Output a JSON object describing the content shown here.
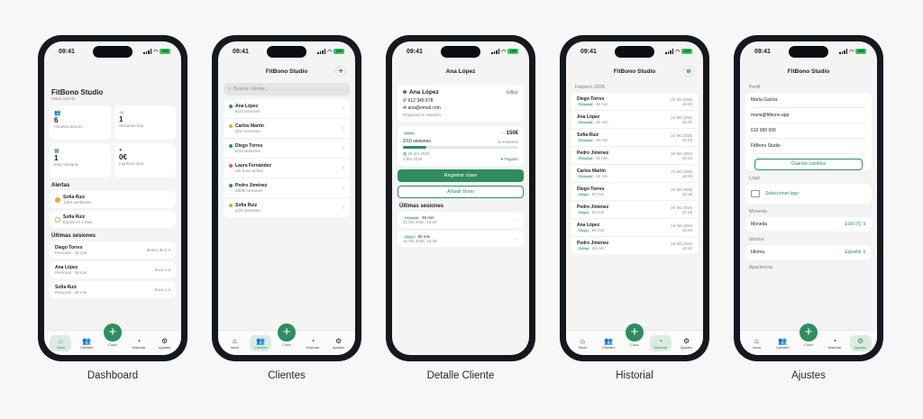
{
  "colors": {
    "accent": "#2f8d5f",
    "warning": "#f0a23a",
    "danger": "#e05a4f",
    "background": "#f6f7f6"
  },
  "status": {
    "time": "09:41",
    "battery": "100"
  },
  "tabs": [
    {
      "label": "Inicio",
      "icon": "home-icon"
    },
    {
      "label": "Clientes",
      "icon": "users-icon"
    },
    {
      "label": "Historial",
      "icon": "clock-icon"
    },
    {
      "label": "Ajustes",
      "icon": "gear-icon"
    }
  ],
  "fab_label": "Clase",
  "captions": [
    "Dashboard",
    "Clientes",
    "Detalle Cliente",
    "Historial",
    "Ajustes"
  ],
  "dashboard": {
    "title": "FitBono Studio",
    "subtitle": "María García",
    "stats": [
      {
        "value": "6",
        "label": "Clientes activos",
        "icon": "users-icon"
      },
      {
        "value": "1",
        "label": "Sesiones hoy",
        "icon": "flame-icon"
      },
      {
        "value": "1",
        "label": "Esta semana",
        "icon": "calendar-icon"
      },
      {
        "value": "0€",
        "label": "Ingresos mes",
        "icon": "money-icon"
      }
    ],
    "alerts_title": "Alertas",
    "alerts": [
      {
        "name": "Sofía Ruiz",
        "detail": "1404 pendiente"
      },
      {
        "name": "Sofía Ruiz",
        "detail": "Expira en 4 días"
      }
    ],
    "sessions_title": "Últimas sesiones",
    "sessions": [
      {
        "name": "Diego Torres",
        "detail": "Personal · 45 min",
        "when": "dentro de 0 s"
      },
      {
        "name": "Ana López",
        "detail": "Personal · 45 min",
        "when": "hace 1 d"
      },
      {
        "name": "Sofía Ruiz",
        "detail": "Personal · 45 min",
        "when": "hace 1 d"
      }
    ]
  },
  "clientes": {
    "title": "FitBono Studio",
    "search_placeholder": "Buscar cliente...",
    "list": [
      {
        "name": "Ana López",
        "detail": "6/10 sesiones",
        "status": "green"
      },
      {
        "name": "Carlos Martín",
        "detail": "3/10 sesiones",
        "status": "orange"
      },
      {
        "name": "Diego Torres",
        "detail": "6/10 sesiones",
        "status": "green"
      },
      {
        "name": "Laura Fernández",
        "detail": "Sin bono activo",
        "status": "red"
      },
      {
        "name": "Pedro Jiménez",
        "detail": "28/36 sesiones",
        "status": "green"
      },
      {
        "name": "Sofía Ruiz",
        "detail": "4/10 sesiones",
        "status": "orange"
      }
    ]
  },
  "detalle": {
    "title": "Ana López",
    "name": "Ana López",
    "edit": "Editar",
    "phone": "612 345 678",
    "email": "ana@email.com",
    "note": "Preparación maratón",
    "bono_status": "Activo",
    "bono_price": "150€",
    "bono_sessions": "2/10 sesiones",
    "bono_remaining": "8 restantes",
    "bono_progress": 0.2,
    "bono_expiry": "25 abr 2026",
    "bono_start": "3 feb 2026",
    "bono_paid": "Pagado",
    "register_btn": "Registrar clase",
    "add_bono_btn": "Añadir bono",
    "sessions_title": "Últimas sesiones",
    "sessions": [
      {
        "type": "Personal",
        "dur": "45 min",
        "date": "22 feb 2026, 18:29"
      },
      {
        "type": "Grupo",
        "dur": "60 min",
        "date": "15 feb 2026, 18:29"
      }
    ]
  },
  "historial": {
    "title": "FitBono Studio",
    "month": "Febrero 2026",
    "rows": [
      {
        "name": "Diego Torres",
        "type": "Personal",
        "dur": "45 min",
        "date": "22 feb 2026",
        "time": "18:29"
      },
      {
        "name": "Ana López",
        "type": "Personal",
        "dur": "45 min",
        "date": "22 feb 2026",
        "time": "18:29"
      },
      {
        "name": "Sofía Ruiz",
        "type": "Personal",
        "dur": "45 min",
        "date": "22 feb 2026",
        "time": "18:29"
      },
      {
        "name": "Pedro Jiménez",
        "type": "Personal",
        "dur": "45 min",
        "date": "22 feb 2026",
        "time": "18:29"
      },
      {
        "name": "Carlos Martín",
        "type": "Personal",
        "dur": "45 min",
        "date": "21 feb 2026",
        "time": "18:29"
      },
      {
        "name": "Diego Torres",
        "type": "Grupo",
        "dur": "60 min",
        "date": "20 feb 2026",
        "time": "18:29"
      },
      {
        "name": "Pedro Jiménez",
        "type": "Grupo",
        "dur": "60 min",
        "date": "20 feb 2026",
        "time": "18:29"
      },
      {
        "name": "Ana López",
        "type": "Grupo",
        "dur": "60 min",
        "date": "19 feb 2026",
        "time": "18:29"
      },
      {
        "name": "Pedro Jiménez",
        "type": "Online",
        "dur": "60 min",
        "date": "18 feb 2026",
        "time": "18:29"
      }
    ]
  },
  "ajustes": {
    "title": "FitBono Studio",
    "perfil_label": "Perfil",
    "name": "María García",
    "email": "maria@fitbono.app",
    "phone": "612 000 000",
    "studio": "FitBono Studio",
    "save_btn": "Guardar cambios",
    "logo_label": "Logo",
    "logo_btn": "Seleccionar logo",
    "moneda_label": "Moneda",
    "moneda_key": "Moneda",
    "moneda_val": "EUR (€)",
    "idioma_label": "Idioma",
    "idioma_key": "Idioma",
    "idioma_val": "Español",
    "apariencia_label": "Apariencia"
  }
}
